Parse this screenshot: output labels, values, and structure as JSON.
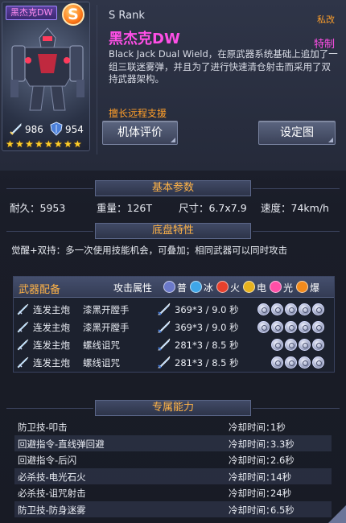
{
  "mech": {
    "name_badge": "黑杰克DW",
    "rank_letter": "S",
    "rank_text": "S Rank",
    "title": "黑杰克DW",
    "tag_private": "私改",
    "tag_special": "特制",
    "description": "Black Jack Dual Wield，在原武器系统基础上追加了一组三联迷雾弹，并且为了进行快速清仓射击而采用了双持武器架构。",
    "specialty": "擅长远程支援",
    "stat_attack": "986",
    "stat_defense": "954",
    "stars": 8,
    "accent_color": "#ff4fe6"
  },
  "buttons": {
    "evaluation": "机体评价",
    "setting": "设定图"
  },
  "basic": {
    "header": "基本参数",
    "durability": "耐久：5953",
    "weight": "重量：126T",
    "size": "尺寸：6.7x7.9",
    "speed": "速度：74km/h"
  },
  "chassis": {
    "header": "底盘特性",
    "trait": "觉醒+双持：多一次使用技能机会，可叠加；相同武器可以同时攻击"
  },
  "weapons": {
    "header": "武器配备",
    "attr_header": "攻击属性",
    "attributes": [
      {
        "icon": "普",
        "label": "普",
        "color": "#6b79c9"
      },
      {
        "icon": "冰",
        "label": "冰",
        "color": "#3fa6e8"
      },
      {
        "icon": "火",
        "label": "火",
        "color": "#e8402c"
      },
      {
        "icon": "电",
        "label": "电",
        "color": "#e8b21e"
      },
      {
        "icon": "光",
        "label": "光",
        "color": "#ff4fa7"
      },
      {
        "icon": "爆",
        "label": "爆",
        "color": "#f28a1c"
      }
    ],
    "rows": [
      {
        "name": "连发主炮",
        "sub": "漆黑开膛手",
        "stat": "369*3 / 9.0 秒",
        "orbs": 5
      },
      {
        "name": "连发主炮",
        "sub": "漆黑开膛手",
        "stat": "369*3 / 9.0 秒",
        "orbs": 5
      },
      {
        "name": "连发主炮",
        "sub": "螺线诅咒",
        "stat": "281*3 / 8.5 秒",
        "orbs": 4
      },
      {
        "name": "连发主炮",
        "sub": "螺线诅咒",
        "stat": "281*3 / 8.5 秒",
        "orbs": 4
      }
    ]
  },
  "abilities": {
    "header": "专属能力",
    "rows": [
      {
        "name": "防卫技-叩击",
        "cd_label": "冷却时间：",
        "cd": "1秒"
      },
      {
        "name": "回避指令-直线弹回避",
        "cd_label": "冷却时间：",
        "cd": "3.3秒"
      },
      {
        "name": "回避指令-后闪",
        "cd_label": "冷却时间：",
        "cd": "2.6秒"
      },
      {
        "name": "必杀技-电光石火",
        "cd_label": "冷却时间：",
        "cd": "14秒"
      },
      {
        "name": "必杀技-诅咒射击",
        "cd_label": "冷却时间：",
        "cd": "24秒"
      },
      {
        "name": "防卫技-防身迷雾",
        "cd_label": "冷却时间：",
        "cd": "6.5秒"
      }
    ]
  }
}
